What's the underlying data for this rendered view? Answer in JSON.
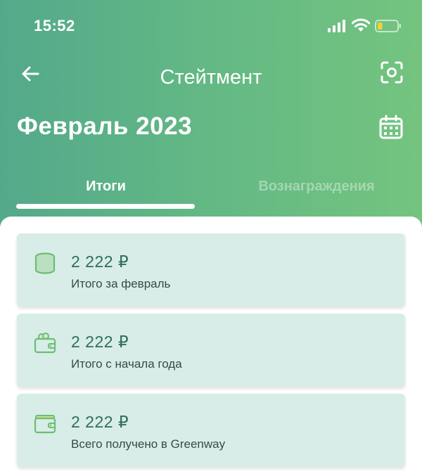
{
  "status_bar": {
    "time": "15:52",
    "battery_level": 0.25,
    "battery_color": "#f2d23a"
  },
  "nav": {
    "title": "Стейтмент",
    "back_icon": "arrow-left-icon",
    "scan_icon": "scan-icon"
  },
  "period": {
    "label": "Февраль 2023",
    "calendar_icon": "calendar-icon"
  },
  "tabs": [
    {
      "label": "Итоги",
      "active": true
    },
    {
      "label": "Вознаграждения",
      "active": false
    }
  ],
  "cards": [
    {
      "amount": "2 222 ₽",
      "label": "Итого за февраль",
      "icon": "coins-stack-icon"
    },
    {
      "amount": "2 222 ₽",
      "label": "Итого с начала года",
      "icon": "wallet-icon"
    },
    {
      "amount": "2 222 ₽",
      "label": "Всего получено в Greenway",
      "icon": "wallet-card-icon"
    }
  ],
  "colors": {
    "header_gradient_start": "#53a98a",
    "header_gradient_end": "#74c47f",
    "card_background": "#d8ede7",
    "amount_text": "#2e6e5e",
    "icon_green": "#6dbd75"
  }
}
